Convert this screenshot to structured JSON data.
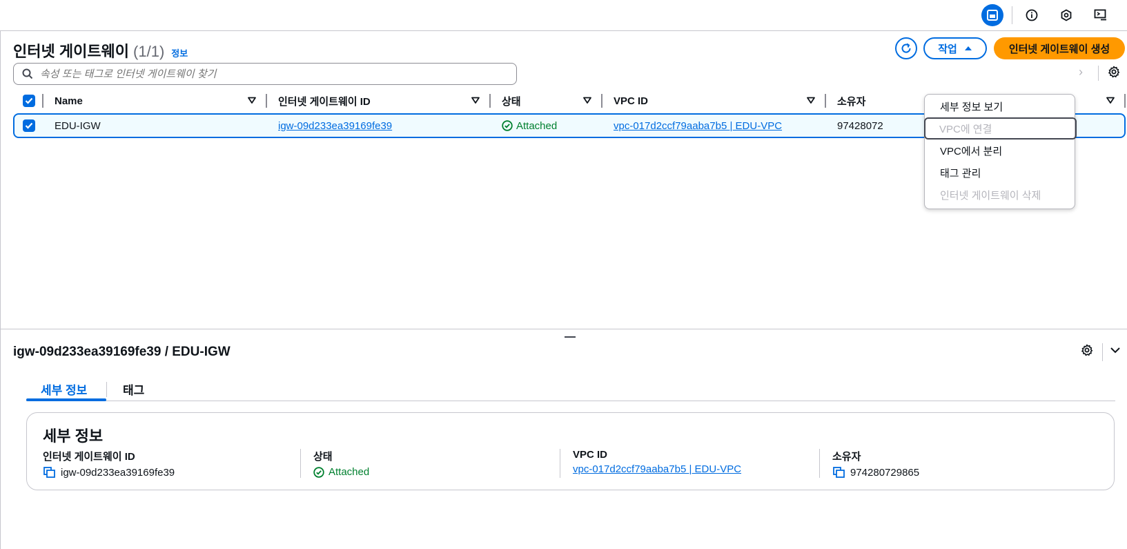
{
  "topbar": {
    "icons": [
      "split-panel-icon",
      "info-icon",
      "cloudshell-icon",
      "feedback-icon"
    ]
  },
  "table_panel": {
    "title": "인터넷 게이트웨이",
    "count": "(1/1)",
    "info_link": "정보",
    "actions_label": "작업",
    "create_label": "인터넷 게이트웨이 생성",
    "search_placeholder": "속성 또는 태그로 인터넷 게이트웨이 찾기",
    "columns": [
      "Name",
      "인터넷 게이트웨이 ID",
      "상태",
      "VPC ID",
      "소유자"
    ],
    "rows": [
      {
        "name": "EDU-IGW",
        "igw_id": "igw-09d233ea39169fe39",
        "state": "Attached",
        "vpc_id": "vpc-017d2ccf79aaba7b5 | EDU-VPC",
        "owner": "97428072"
      }
    ]
  },
  "actions_menu": {
    "items": [
      {
        "label": "세부 정보 보기",
        "enabled": true
      },
      {
        "label": "VPC에 연결",
        "enabled": false
      },
      {
        "label": "VPC에서 분리",
        "enabled": true
      },
      {
        "label": "태그 관리",
        "enabled": true
      },
      {
        "label": "인터넷 게이트웨이 삭제",
        "enabled": false
      }
    ]
  },
  "detail_panel": {
    "title": "igw-09d233ea39169fe39 / EDU-IGW",
    "tabs": [
      "세부 정보",
      "태그"
    ],
    "active_tab": "세부 정보",
    "card_title": "세부 정보",
    "fields": [
      {
        "label": "인터넷 게이트웨이 ID",
        "value": "igw-09d233ea39169fe39"
      },
      {
        "label": "상태",
        "value": "Attached"
      },
      {
        "label": "VPC ID",
        "value": "vpc-017d2ccf79aaba7b5 | EDU-VPC"
      },
      {
        "label": "소유자",
        "value": "974280729865"
      }
    ]
  },
  "colors": {
    "accent": "#006ce0",
    "primary_button": "#ff9900",
    "success": "#00802f",
    "selected_row_bg": "#f0fbff"
  }
}
